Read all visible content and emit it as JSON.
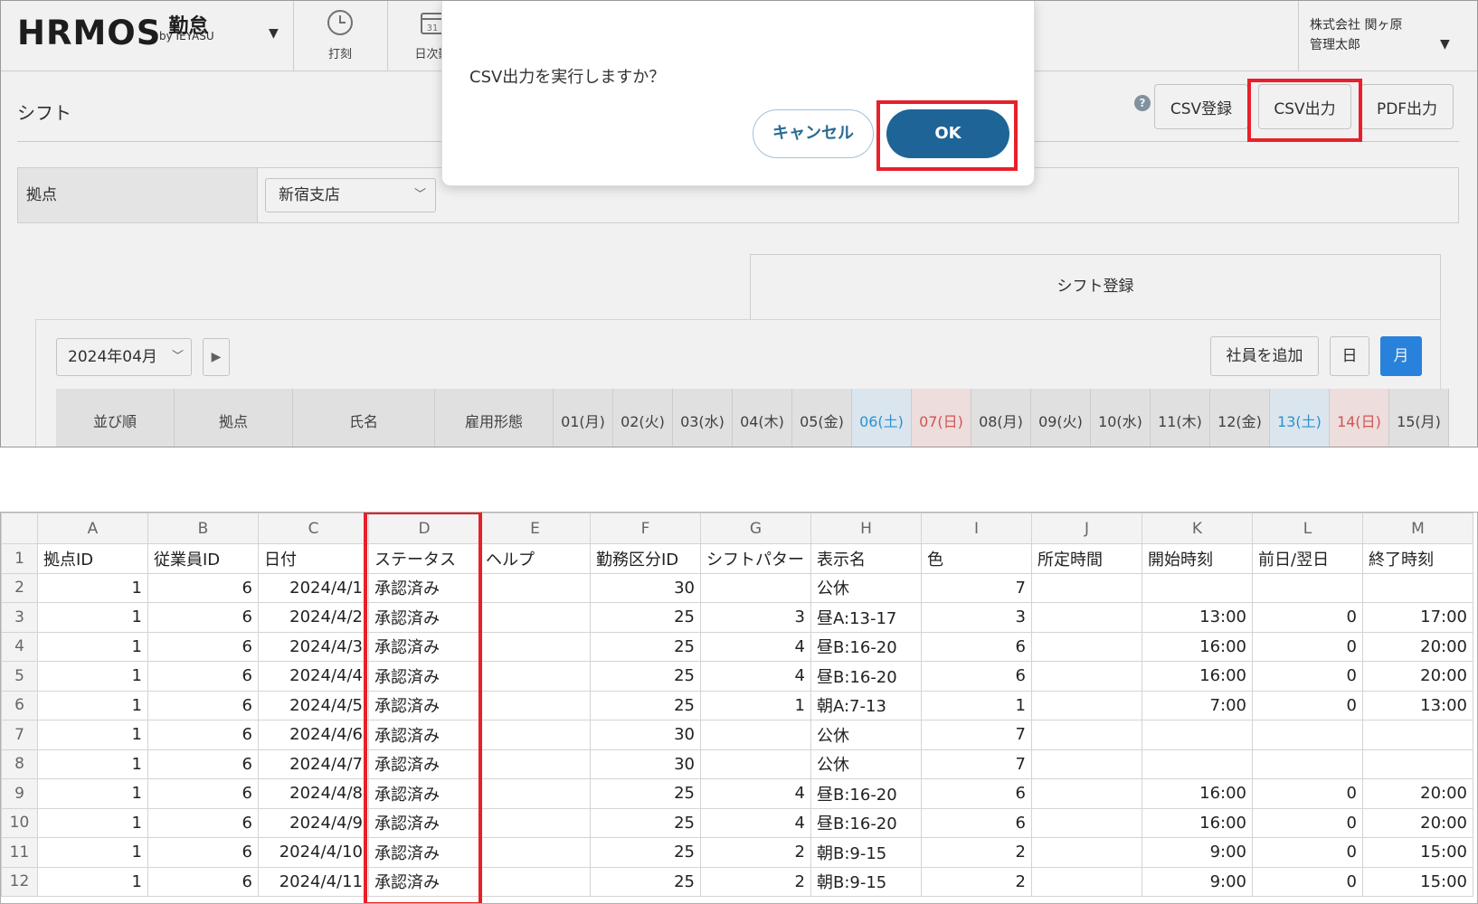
{
  "app": {
    "logo": {
      "main": "HRMOS",
      "kintai": "勤怠",
      "by": "by IEYASU"
    },
    "nav": [
      {
        "label": "打刻"
      },
      {
        "label": "日次勤"
      }
    ],
    "user": {
      "company": "株式会社 関ヶ原",
      "name": "管理太郎"
    },
    "page_title": "シフト",
    "header_buttons": {
      "csv_register": "CSV登録",
      "csv_export": "CSV出力",
      "pdf_export": "PDF出力"
    },
    "filter": {
      "label": "拠点",
      "value": "新宿支店"
    },
    "tab_label": "シフト登録",
    "month": "2024年04月",
    "buttons": {
      "add_employee": "社員を追加",
      "day": "日",
      "month": "月"
    },
    "grid_headers": [
      "並び順",
      "拠点",
      "氏名",
      "雇用形態"
    ],
    "days": [
      {
        "d": "01",
        "w": "(月)",
        "t": ""
      },
      {
        "d": "02",
        "w": "(火)",
        "t": ""
      },
      {
        "d": "03",
        "w": "(水)",
        "t": ""
      },
      {
        "d": "04",
        "w": "(木)",
        "t": ""
      },
      {
        "d": "05",
        "w": "(金)",
        "t": ""
      },
      {
        "d": "06",
        "w": "(土)",
        "t": "sat"
      },
      {
        "d": "07",
        "w": "(日)",
        "t": "sun"
      },
      {
        "d": "08",
        "w": "(月)",
        "t": ""
      },
      {
        "d": "09",
        "w": "(火)",
        "t": ""
      },
      {
        "d": "10",
        "w": "(水)",
        "t": ""
      },
      {
        "d": "11",
        "w": "(木)",
        "t": ""
      },
      {
        "d": "12",
        "w": "(金)",
        "t": ""
      },
      {
        "d": "13",
        "w": "(土)",
        "t": "sat"
      },
      {
        "d": "14",
        "w": "(日)",
        "t": "sun"
      },
      {
        "d": "15",
        "w": "(月)",
        "t": ""
      }
    ],
    "dialog": {
      "message": "CSV出力を実行しますか？",
      "cancel": "キャンセル",
      "ok": "OK"
    },
    "colors": {
      "ok_button": "#1e6497",
      "active_toggle": "#2b8ae8",
      "highlight": "#e8202a",
      "saturday": "#2b9be0",
      "sunday": "#e05858"
    }
  },
  "sheet": {
    "columns": [
      "A",
      "B",
      "C",
      "D",
      "E",
      "F",
      "G",
      "H",
      "I",
      "J",
      "K",
      "L",
      "M"
    ],
    "header": [
      "拠点ID",
      "従業員ID",
      "日付",
      "ステータス",
      "ヘルプ",
      "勤務区分ID",
      "シフトパター",
      "表示名",
      "色",
      "所定時間",
      "開始時刻",
      "前日/翌日",
      "終了時刻"
    ],
    "rows": [
      [
        "1",
        "6",
        "2024/4/1",
        "承認済み",
        "",
        "30",
        "",
        "公休",
        "7",
        "",
        "",
        "",
        ""
      ],
      [
        "1",
        "6",
        "2024/4/2",
        "承認済み",
        "",
        "25",
        "3",
        "昼A:13-17",
        "3",
        "",
        "13:00",
        "0",
        "17:00"
      ],
      [
        "1",
        "6",
        "2024/4/3",
        "承認済み",
        "",
        "25",
        "4",
        "昼B:16-20",
        "6",
        "",
        "16:00",
        "0",
        "20:00"
      ],
      [
        "1",
        "6",
        "2024/4/4",
        "承認済み",
        "",
        "25",
        "4",
        "昼B:16-20",
        "6",
        "",
        "16:00",
        "0",
        "20:00"
      ],
      [
        "1",
        "6",
        "2024/4/5",
        "承認済み",
        "",
        "25",
        "1",
        "朝A:7-13",
        "1",
        "",
        "7:00",
        "0",
        "13:00"
      ],
      [
        "1",
        "6",
        "2024/4/6",
        "承認済み",
        "",
        "30",
        "",
        "公休",
        "7",
        "",
        "",
        "",
        ""
      ],
      [
        "1",
        "6",
        "2024/4/7",
        "承認済み",
        "",
        "30",
        "",
        "公休",
        "7",
        "",
        "",
        "",
        ""
      ],
      [
        "1",
        "6",
        "2024/4/8",
        "承認済み",
        "",
        "25",
        "4",
        "昼B:16-20",
        "6",
        "",
        "16:00",
        "0",
        "20:00"
      ],
      [
        "1",
        "6",
        "2024/4/9",
        "承認済み",
        "",
        "25",
        "4",
        "昼B:16-20",
        "6",
        "",
        "16:00",
        "0",
        "20:00"
      ],
      [
        "1",
        "6",
        "2024/4/10",
        "承認済み",
        "",
        "25",
        "2",
        "朝B:9-15",
        "2",
        "",
        "9:00",
        "0",
        "15:00"
      ],
      [
        "1",
        "6",
        "2024/4/11",
        "承認済み",
        "",
        "25",
        "2",
        "朝B:9-15",
        "2",
        "",
        "9:00",
        "0",
        "15:00"
      ]
    ]
  }
}
